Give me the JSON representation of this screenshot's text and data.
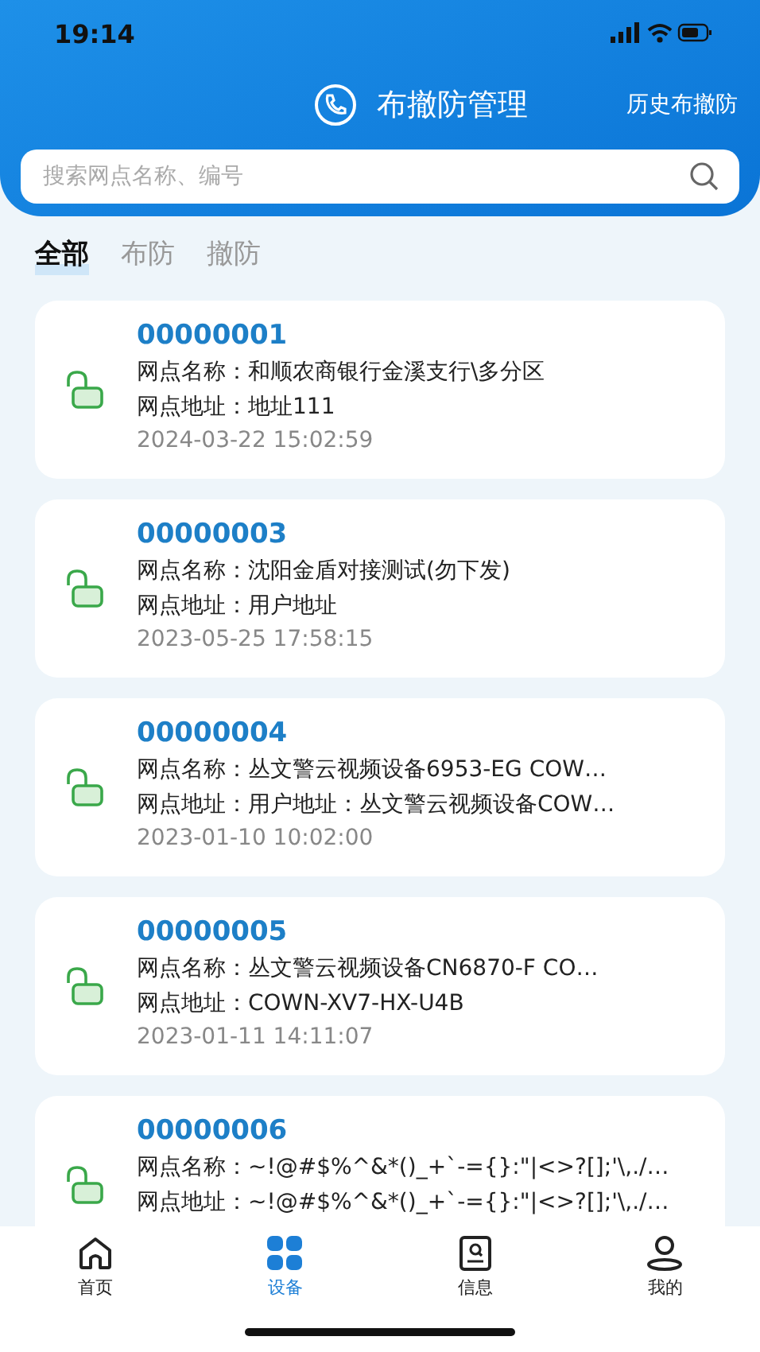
{
  "status_bar": {
    "time": "19:14"
  },
  "header": {
    "title": "布撤防管理",
    "history_link": "历史布撤防"
  },
  "search": {
    "placeholder": "搜索网点名称、编号"
  },
  "filter_tabs": [
    {
      "label": "全部",
      "selected": true
    },
    {
      "label": "布防",
      "selected": false
    },
    {
      "label": "撤防",
      "selected": false
    }
  ],
  "sites": [
    {
      "id": "00000001",
      "name": "网点名称：和顺农商银行金溪支行\\多分区",
      "address": "网点地址：地址111",
      "time": "2024-03-22 15:02:59",
      "armed": false
    },
    {
      "id": "00000003",
      "name": "网点名称：沈阳金盾对接测试(勿下发)",
      "address": "网点地址：用户地址",
      "time": "2023-05-25 17:58:15",
      "armed": false
    },
    {
      "id": "00000004",
      "name": "网点名称：丛文警云视频设备6953-EG COW…",
      "address": "网点地址：用户地址：丛文警云视频设备COW…",
      "time": "2023-01-10 10:02:00",
      "armed": false
    },
    {
      "id": "00000005",
      "name": "网点名称：丛文警云视频设备CN6870-F CO…",
      "address": "网点地址：COWN-XV7-HX-U4B",
      "time": "2023-01-11 14:11:07",
      "armed": false
    },
    {
      "id": "00000006",
      "name": "网点名称：~!@#$%^&*()_+`-={}:\"|<>?[];'\\,./…",
      "address": "网点地址：~!@#$%^&*()_+`-={}:\"|<>?[];'\\,./…",
      "armed": false
    }
  ],
  "bottom_nav": [
    {
      "label": "首页",
      "kind": "home",
      "selected": false
    },
    {
      "label": "设备",
      "kind": "grid",
      "selected": true
    },
    {
      "label": "信息",
      "kind": "search",
      "selected": false
    },
    {
      "label": "我的",
      "kind": "person",
      "selected": false
    }
  ]
}
